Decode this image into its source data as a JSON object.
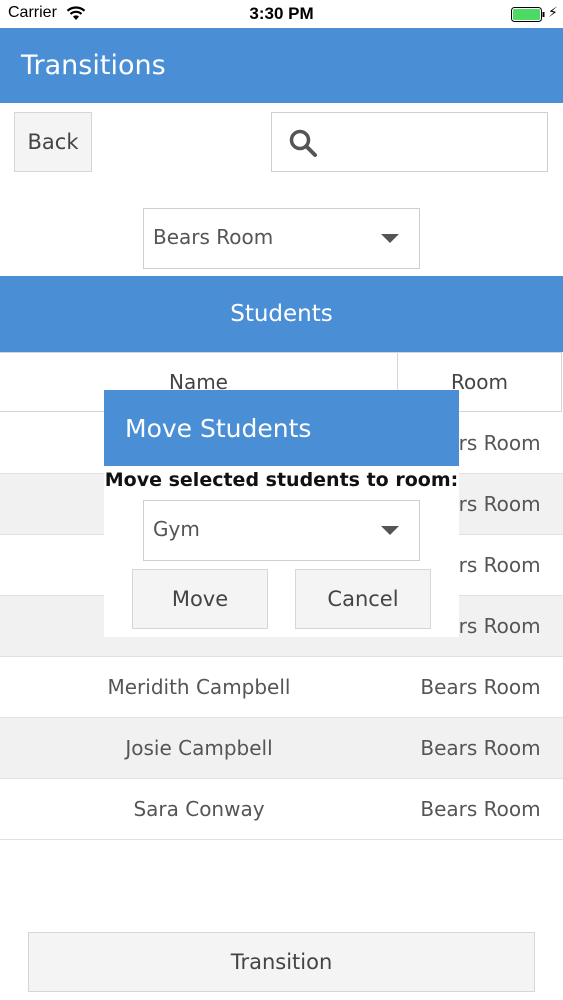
{
  "status_bar": {
    "carrier": "Carrier",
    "time": "3:30 PM",
    "battery_color": "#4cd964"
  },
  "header": {
    "title": "Transitions"
  },
  "toolbar": {
    "back_label": "Back",
    "search_placeholder": "",
    "search_value": ""
  },
  "room_filter": {
    "selected": "Bears Room"
  },
  "students_section": {
    "title": "Students"
  },
  "table": {
    "columns": [
      "Name",
      "Room"
    ],
    "rows": [
      {
        "name": "",
        "room": "Bears Room"
      },
      {
        "name": "",
        "room": "Bears Room"
      },
      {
        "name": "",
        "room": "Bears Room"
      },
      {
        "name": "",
        "room": "Bears Room"
      },
      {
        "name": "Meridith Campbell",
        "room": "Bears Room"
      },
      {
        "name": "Josie Campbell",
        "room": "Bears Room"
      },
      {
        "name": "Sara Conway",
        "room": "Bears Room"
      }
    ]
  },
  "modal": {
    "title": "Move Students",
    "prompt": "Move selected students to room:",
    "selected_room": "Gym",
    "move_label": "Move",
    "cancel_label": "Cancel"
  },
  "footer": {
    "transition_label": "Transition"
  },
  "colors": {
    "accent": "#4a8ed6",
    "row_alt": "#f1f1f1"
  }
}
